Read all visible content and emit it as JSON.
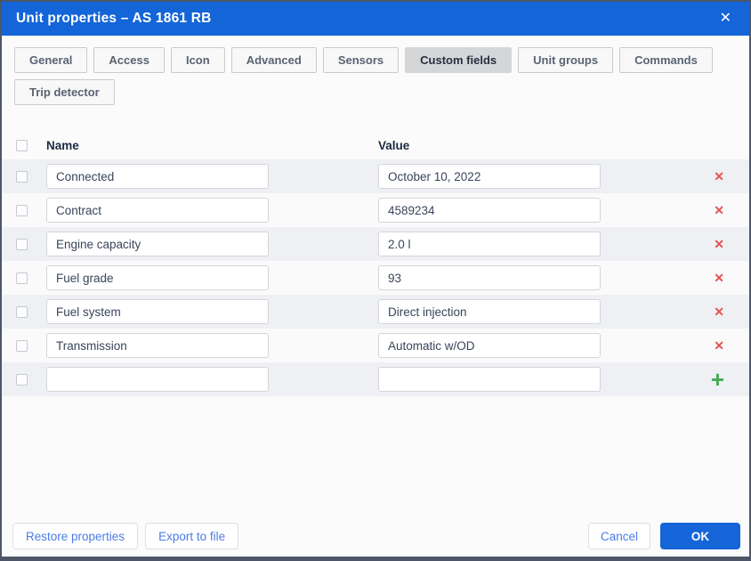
{
  "dialog": {
    "title": "Unit properties – AS 1861 RB"
  },
  "icons": {
    "close": "✕",
    "delete": "✕",
    "add": "+"
  },
  "colors": {
    "accent_blue": "#1465d8",
    "delete_red": "#e25352",
    "add_green": "#45ab52",
    "active_tab_bg": "#d5d6d8",
    "row_stripe": "#eff0f3",
    "dialog_border": "#4d5669"
  },
  "tabs": [
    {
      "label": "General",
      "active": false
    },
    {
      "label": "Access",
      "active": false
    },
    {
      "label": "Icon",
      "active": false
    },
    {
      "label": "Advanced",
      "active": false
    },
    {
      "label": "Sensors",
      "active": false
    },
    {
      "label": "Custom fields",
      "active": true
    },
    {
      "label": "Unit groups",
      "active": false
    },
    {
      "label": "Commands",
      "active": false
    },
    {
      "label": "Trip detector",
      "active": false
    }
  ],
  "table": {
    "columns": {
      "name": "Name",
      "value": "Value"
    },
    "select_all_checked": false,
    "rows": [
      {
        "name": "Connected",
        "value": "October 10, 2022",
        "checked": false
      },
      {
        "name": "Contract",
        "value": "4589234",
        "checked": false
      },
      {
        "name": "Engine capacity",
        "value": "2.0 l",
        "checked": false
      },
      {
        "name": "Fuel grade",
        "value": "93",
        "checked": false
      },
      {
        "name": "Fuel system",
        "value": "Direct injection",
        "checked": false
      },
      {
        "name": "Transmission",
        "value": "Automatic w/OD",
        "checked": false
      }
    ],
    "new_row": {
      "name": "",
      "value": ""
    }
  },
  "footer": {
    "restore_label": "Restore properties",
    "export_label": "Export to file",
    "cancel_label": "Cancel",
    "ok_label": "OK"
  }
}
